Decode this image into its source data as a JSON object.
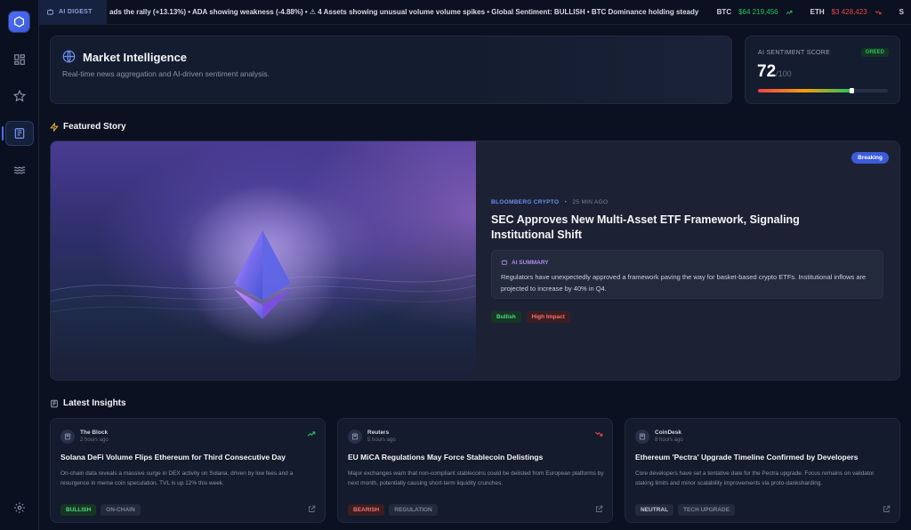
{
  "ticker": {
    "badge": "AI DIGEST",
    "text": "ads the rally (+13.13%) • ADA showing weakness (-4.88%) • ⚠ 4 Assets showing unusual volume volume spikes • Global Sentiment: BULLISH • BTC Dominance holding steady",
    "prices": [
      {
        "symbol": "BTC",
        "value": "$64 219,456",
        "direction": "up"
      },
      {
        "symbol": "ETH",
        "value": "$3 428,423",
        "direction": "down"
      },
      {
        "symbol": "S",
        "value": "",
        "direction": ""
      }
    ]
  },
  "header": {
    "title": "Market Intelligence",
    "subtitle": "Real-time news aggregation and AI-driven sentiment analysis."
  },
  "sentiment": {
    "label": "AI SENTIMENT SCORE",
    "badge": "GREED",
    "value": "72",
    "max": "/100",
    "level": 0.72
  },
  "featured_section": {
    "title": "Featured Story"
  },
  "featured": {
    "badge": "Breaking",
    "source": "BLOOMBERG CRYPTO",
    "time": "25 MIN AGO",
    "title": "SEC Approves New Multi-Asset ETF Framework, Signaling Institutional Shift",
    "ai_label": "AI SUMMARY",
    "ai_text": "Regulators have unexpectedly approved a framework paving the way for basket-based crypto ETFs. Institutional inflows are projected to increase by 40% in Q4.",
    "tags": [
      "Bullish",
      "High Impact"
    ]
  },
  "insights_section": {
    "title": "Latest Insights"
  },
  "insights": [
    {
      "source": "The Block",
      "time": "2 hours ago",
      "trend": "up",
      "title": "Solana DeFi Volume Flips Ethereum for Third Consecutive Day",
      "body": "On-chain data reveals a massive surge in DEX activity on Solana, driven by low fees and a resurgence in meme coin speculation. TVL is up 12% this week.",
      "tags": [
        "BULLISH",
        "ON-CHAIN"
      ]
    },
    {
      "source": "Reuters",
      "time": "5 hours ago",
      "trend": "down",
      "title": "EU MiCA Regulations May Force Stablecoin Delistings",
      "body": "Major exchanges warn that non-compliant stablecoins could be delisted from European platforms by next month, potentially causing short-term liquidity crunches.",
      "tags": [
        "BEARISH",
        "REGULATION"
      ]
    },
    {
      "source": "CoinDesk",
      "time": "8 hours ago",
      "trend": "",
      "title": "Ethereum 'Pectra' Upgrade Timeline Confirmed by Developers",
      "body": "Core developers have set a tentative date for the Pectra upgrade. Focus remains on validator staking limits and minor scalability improvements via proto-danksharding.",
      "tags": [
        "NEUTRAL",
        "TECH UPGRADE"
      ]
    }
  ]
}
